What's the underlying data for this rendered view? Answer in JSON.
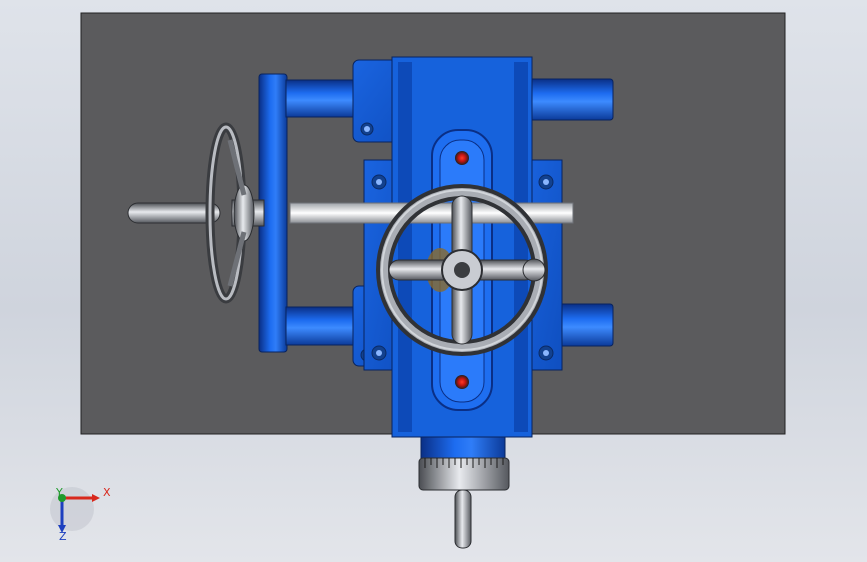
{
  "viewport": {
    "background_top": "#dfe3ea",
    "background_bottom": "#cfd4dd",
    "baseplate_color": "#5b5b5d",
    "part_blue": "#1560d8",
    "part_blue_dark": "#0b3a99",
    "steel": "#9a9ea6"
  },
  "triad": {
    "x_label": "X",
    "y_label": "Y",
    "z_label": "Z",
    "x_color": "#d8281c",
    "y_color": "#1f9a2c",
    "z_color": "#1d3fbf"
  },
  "icons": [
    "handwheel-icon",
    "triad-icon",
    "graduated-dial-icon"
  ]
}
